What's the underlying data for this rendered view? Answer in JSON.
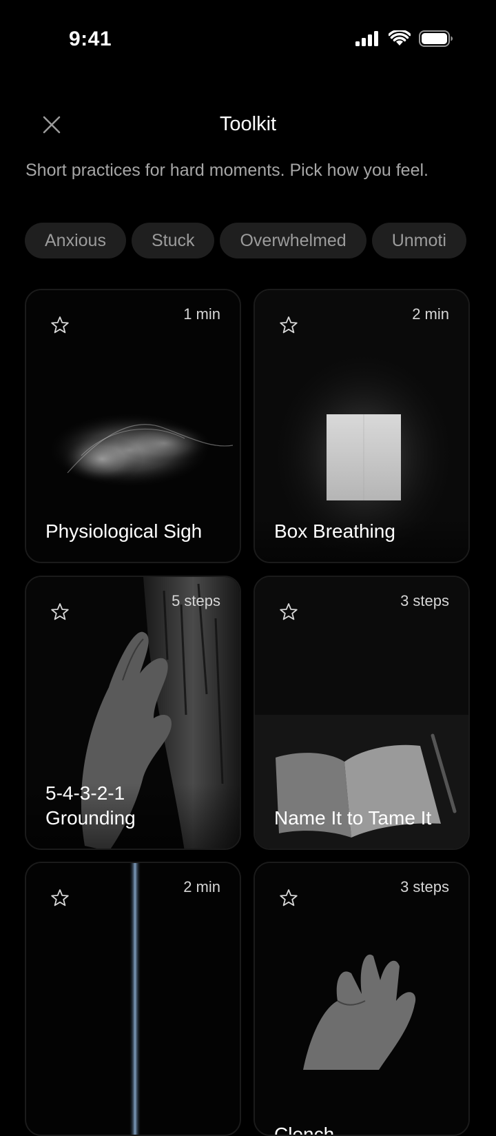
{
  "status": {
    "time": "9:41"
  },
  "header": {
    "title": "Toolkit"
  },
  "subtitle": "Short practices for hard moments. Pick how you feel.",
  "chips": [
    "Anxious",
    "Stuck",
    "Overwhelmed",
    "Unmoti"
  ],
  "cards": [
    {
      "name": "Physiological Sigh",
      "meta": "1 min",
      "image": "smoke-wisp"
    },
    {
      "name": "Box Breathing",
      "meta": "2 min",
      "image": "lit-doorway"
    },
    {
      "name": "5-4-3-2-1\nGrounding",
      "meta": "5 steps",
      "image": "hand-on-bark"
    },
    {
      "name": "Name It to Tame It",
      "meta": "3 steps",
      "image": "open-notebook"
    },
    {
      "name": "",
      "meta": "2 min",
      "image": "light-beam"
    },
    {
      "name": "Clench",
      "meta": "3 steps",
      "image": "open-hand"
    }
  ],
  "icons": {
    "close": "close-icon",
    "star": "star-outline-icon"
  }
}
